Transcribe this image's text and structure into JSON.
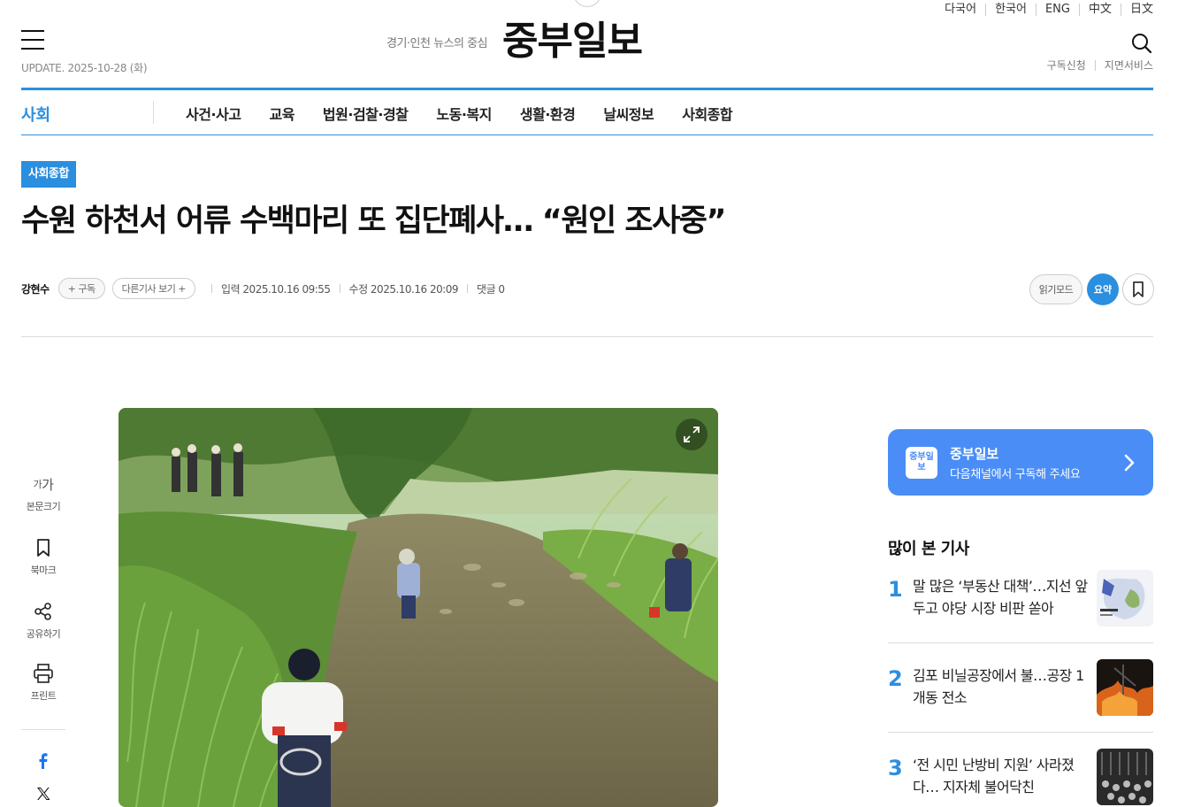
{
  "header": {
    "languages": [
      "다국어",
      "한국어",
      "ENG",
      "中文",
      "日文"
    ],
    "update_text": "UPDATE. 2025-10-28 (화)",
    "logo_subtitle": "경기·인천 뉴스의 중심",
    "logo_text": "중부일보",
    "links": [
      "구독신청",
      "지면서비스"
    ]
  },
  "nav": {
    "section": "사회",
    "items": [
      "사건·사고",
      "교육",
      "법원·검찰·경찰",
      "노동·복지",
      "생활·환경",
      "날씨정보",
      "사회종합"
    ]
  },
  "article": {
    "category": "사회종합",
    "headline": "수원 하천서 어류 수백마리 또 집단폐사… “원인 조사중”",
    "reporter": "강현수",
    "subscribe_pill": "+ 구독",
    "other_articles_pill": "다른기사 보기 +",
    "published": "입력 2025.10.16 09:55",
    "modified": "수정 2025.10.16 20:09",
    "comments": "댓글 0",
    "read_mode_label": "읽기모드",
    "summary_label": "요약"
  },
  "tools": {
    "font_size_glyph": "가가",
    "font_size_label": "본문크기",
    "bookmark_label": "북마크",
    "share_label": "공유하기",
    "print_label": "프린트"
  },
  "sidebar": {
    "banner_logo": "중부일보",
    "banner_title": "중부일보",
    "banner_desc": "다음채널에서 구독해 주세요",
    "popular_title": "많이 본 기사",
    "popular": [
      {
        "rank": "1",
        "title": "말 많은 ‘부동산 대책’…지선 앞두고 야당 시장 비판 쏟아"
      },
      {
        "rank": "2",
        "title": "김포 비닐공장에서 불…공장 1개동 전소"
      },
      {
        "rank": "3",
        "title": "‘전 시민 난방비 지원’ 사라졌다… 지자체 불어닥친"
      }
    ]
  },
  "colors": {
    "accent": "#2b8fe0",
    "banner": "#4a8df6"
  }
}
